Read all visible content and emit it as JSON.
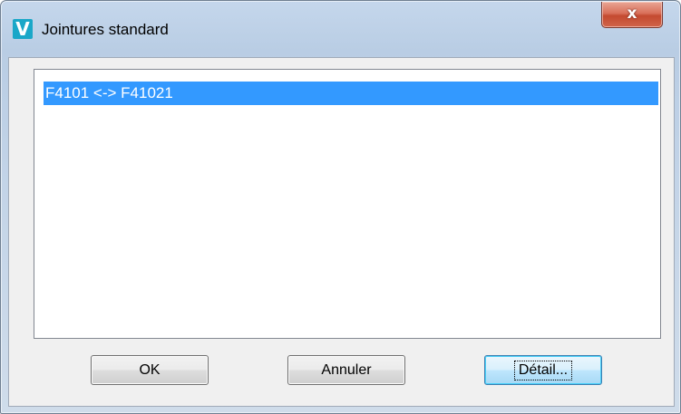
{
  "window": {
    "title": "Jointures standard",
    "icon_letter": "V",
    "close_glyph": "x"
  },
  "list": {
    "items": [
      {
        "label": "F4101 <-> F41021",
        "selected": true
      }
    ]
  },
  "buttons": {
    "ok": "OK",
    "cancel": "Annuler",
    "detail": "Détail..."
  },
  "colors": {
    "selection": "#3399ff",
    "app_icon": "#1aa7c8",
    "close_button": "#c44a30"
  }
}
